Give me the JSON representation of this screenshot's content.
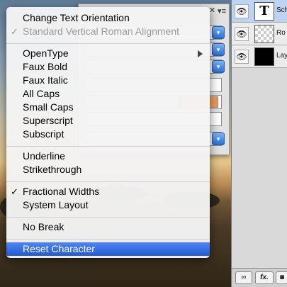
{
  "menu": {
    "items": [
      {
        "label": "Change Text Orientation",
        "checked": false,
        "disabled": false
      },
      {
        "label": "Standard Vertical Roman Alignment",
        "checked": true,
        "disabled": true
      },
      {
        "label": "OpenType",
        "submenu": true
      },
      {
        "label": "Faux Bold"
      },
      {
        "label": "Faux Italic"
      },
      {
        "label": "All Caps"
      },
      {
        "label": "Small Caps"
      },
      {
        "label": "Superscript"
      },
      {
        "label": "Subscript"
      },
      {
        "label": "Underline"
      },
      {
        "label": "Strikethrough"
      },
      {
        "label": "Fractional Widths",
        "checked": true
      },
      {
        "label": "System Layout"
      },
      {
        "label": "No Break"
      },
      {
        "label": "Reset Character",
        "highlighted": true
      }
    ],
    "check_glyph": "✓"
  },
  "layers": {
    "rows": [
      {
        "name": "Sch",
        "thumb": "text",
        "thumb_glyph": "T",
        "selected": true
      },
      {
        "name": "Ro",
        "thumb": "transparent"
      },
      {
        "name": "Lay",
        "thumb": "black"
      }
    ],
    "eye_glyph": "👁",
    "footer": {
      "link_label": "∞",
      "fx_label": "fx.",
      "mask_label": "◙"
    }
  },
  "panel": {
    "close_glyph": "✕",
    "menu_glyph": "▾≡",
    "dropdown_glyph": "▾"
  }
}
